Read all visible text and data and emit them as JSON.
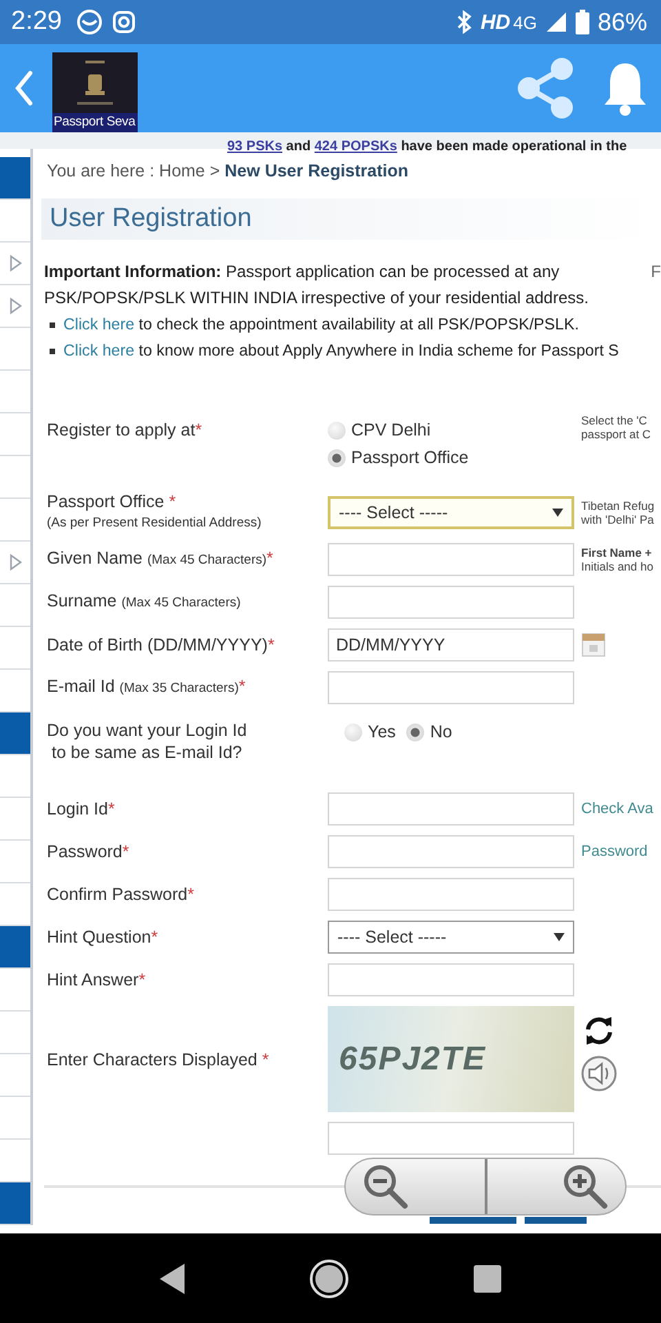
{
  "status_bar": {
    "time": "2:29",
    "network": "HD",
    "network_type": "4G",
    "battery": "86%"
  },
  "app_bar": {
    "logo_caption": "Passport Seva"
  },
  "ticker": {
    "parts": [
      {
        "kind": "link",
        "text": "93 PSKs"
      },
      {
        "kind": "text",
        "text": " and "
      },
      {
        "kind": "link",
        "text": "424 POPSKs"
      },
      {
        "kind": "text",
        "text": " have been made operational in the"
      }
    ]
  },
  "sidebar": {
    "items": [
      {
        "selected": true,
        "expandable": false
      },
      {
        "selected": false,
        "expandable": false
      },
      {
        "selected": false,
        "expandable": true
      },
      {
        "selected": false,
        "expandable": true
      },
      {
        "selected": false,
        "expandable": false
      },
      {
        "selected": false,
        "expandable": false
      },
      {
        "selected": false,
        "expandable": false
      },
      {
        "selected": false,
        "expandable": false
      },
      {
        "selected": false,
        "expandable": false
      },
      {
        "selected": false,
        "expandable": true
      },
      {
        "selected": false,
        "expandable": false
      },
      {
        "selected": false,
        "expandable": false
      },
      {
        "selected": false,
        "expandable": false
      },
      {
        "selected": true,
        "expandable": false
      },
      {
        "selected": false,
        "expandable": false
      },
      {
        "selected": false,
        "expandable": false
      },
      {
        "selected": false,
        "expandable": false
      },
      {
        "selected": false,
        "expandable": false
      },
      {
        "selected": true,
        "expandable": false
      },
      {
        "selected": false,
        "expandable": false
      },
      {
        "selected": false,
        "expandable": false
      },
      {
        "selected": false,
        "expandable": false
      },
      {
        "selected": false,
        "expandable": false
      },
      {
        "selected": false,
        "expandable": false
      },
      {
        "selected": true,
        "expandable": false
      }
    ]
  },
  "breadcrumb": "You are here : Home > **New User Registration**",
  "title": "User Registration",
  "info": {
    "text": "**Important Information:** Passport application can be processed at any PSK/POPSK/PSLK WITHIN INDIA irrespective of your residential address.",
    "side": "F",
    "bullets": [
      {
        "link": "Click here",
        "text": " to check the appointment availability at all PSK/POPSK/PSLK."
      },
      {
        "link": "Click here",
        "text": " to know more about Apply Anywhere in India scheme for Passport S"
      }
    ]
  },
  "form": {
    "rows": [
      {
        "kind": "radio",
        "label": {
          "text": "Register to apply at",
          "mark": "*"
        },
        "inline": false,
        "options": [
          {
            "label": "CPV Delhi",
            "selected": false
          },
          {
            "label": "Passport Office",
            "selected": true
          }
        ],
        "hint": {
          "kind": "note",
          "text": "Select the 'C\npassport at C"
        }
      },
      {
        "kind": "select",
        "label": {
          "text": "Passport Office ",
          "mark": "*",
          "note_below": "(As per Present Residential Address)"
        },
        "value": "---- Select -----",
        "focused": true,
        "hint": {
          "kind": "note",
          "text": "Tibetan Refug\nwith 'Delhi' Pa"
        }
      },
      {
        "kind": "text",
        "label": {
          "text": "Given Name ",
          "note": "(Max 45 Characters)",
          "mark": "*"
        },
        "hint": {
          "kind": "note",
          "text": "**First Name +**\nInitials and ho"
        }
      },
      {
        "kind": "text",
        "label": {
          "text": "Surname ",
          "note": "(Max 45 Characters)"
        }
      },
      {
        "kind": "date",
        "label": {
          "text": "Date of Birth (DD/MM/YYYY)",
          "mark": "*"
        },
        "value": "DD/MM/YYYY"
      },
      {
        "kind": "text",
        "label": {
          "text": "E-mail Id ",
          "note": "(Max 35 Characters)",
          "mark": "*"
        }
      },
      {
        "kind": "radio",
        "label": {
          "text": "Do you want your Login Id\nto be same as E-mail Id?"
        },
        "inline": true,
        "options": [
          {
            "label": "Yes",
            "selected": false
          },
          {
            "label": "No",
            "selected": true
          }
        ]
      },
      {
        "kind": "text",
        "label": {
          "text": "Login Id",
          "mark": "*"
        },
        "hint": {
          "kind": "link",
          "text": "Check Ava"
        }
      },
      {
        "kind": "text",
        "label": {
          "text": "Password",
          "mark": "*"
        },
        "hint": {
          "kind": "link",
          "text": "Password"
        }
      },
      {
        "kind": "text",
        "label": {
          "text": "Confirm Password",
          "mark": "*"
        }
      },
      {
        "kind": "select",
        "label": {
          "text": "Hint Question",
          "mark": "*"
        },
        "value": "---- Select -----",
        "focused": false
      },
      {
        "kind": "text",
        "label": {
          "text": "Hint Answer",
          "mark": "*"
        }
      },
      {
        "kind": "captcha",
        "label": {
          "text": "Enter Characters Displayed ",
          "mark": "*"
        },
        "captcha": "65PJ2TE"
      }
    ]
  }
}
